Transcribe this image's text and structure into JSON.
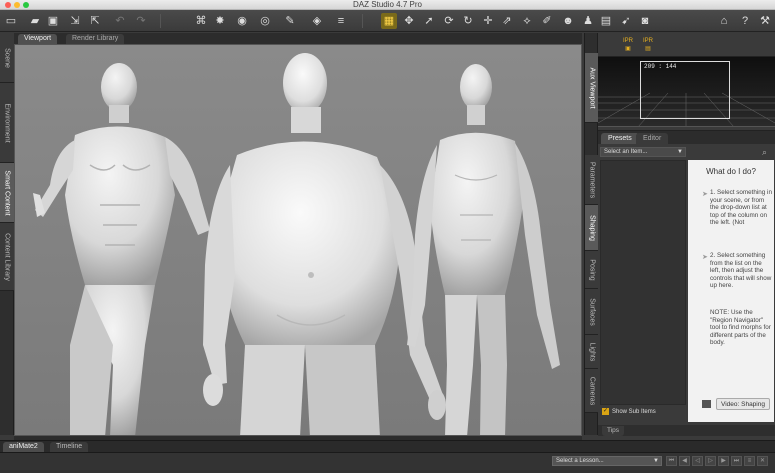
{
  "window": {
    "title": "DAZ Studio 4.7 Pro"
  },
  "toolbar": {
    "icons": [
      "new-scene-icon",
      "open-icon",
      "save-icon",
      "merge-icon",
      "export-icon",
      "undo-icon",
      "redo-icon",
      "camera-cube-icon",
      "light-icon",
      "spot-light-icon",
      "point-light-icon",
      "paint-icon",
      "primitive-icon",
      "select-tool-icon",
      "universal-tool-icon",
      "rotate-tool-icon",
      "translate-tool-icon",
      "scale-tool-icon",
      "joint-tool-icon",
      "surface-tool-icon",
      "node-weight-icon",
      "geometry-edit-icon",
      "render-icon",
      "home-icon",
      "help-icon",
      "tools-icon"
    ]
  },
  "left_tabs": [
    "Scene",
    "Environment",
    "Smart Content",
    "Content Library"
  ],
  "viewport": {
    "tabs": [
      "Viewport",
      "Render Library"
    ],
    "active_tab": "Viewport"
  },
  "right_tabs": [
    "Aux Viewport",
    "Parameters",
    "Shaping",
    "Posing",
    "Surfaces",
    "Lights",
    "Cameras"
  ],
  "aux": {
    "ipr_label": "IPR",
    "dimensions": "209 : 144"
  },
  "panel": {
    "tabs": [
      "Presets",
      "Editor"
    ],
    "active_tab": "Presets",
    "select_placeholder": "Select an Item...",
    "show_sub_items": "Show Sub Items",
    "help_title": "What do I do?",
    "steps": [
      "1. Select something in your scene, or from the drop-down list at top of the column on the left. (Not",
      "2. Select something from the list on the left, then adjust the controls that will show up here."
    ],
    "note": "NOTE: Use the \"Region Navigator\" tool to find morphs for different parts of the body.",
    "video_button": "Video: Shaping"
  },
  "tips_tab": "Tips",
  "bottom": {
    "tabs": [
      "aniMate2",
      "Timeline"
    ],
    "active_tab": "aniMate2",
    "lesson_placeholder": "Select a Lesson..."
  }
}
